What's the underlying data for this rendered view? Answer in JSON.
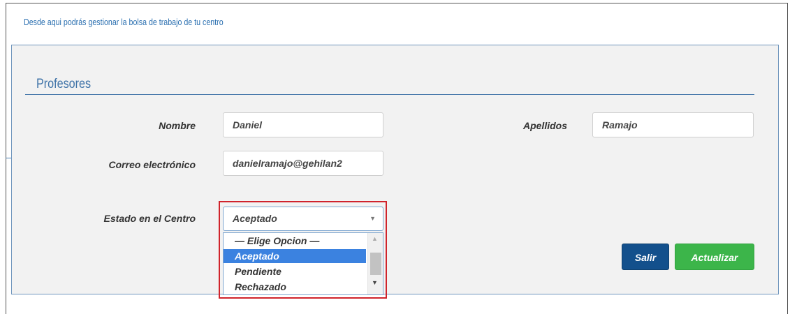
{
  "intro_text": "Desde aqui podrás gestionar la bolsa de trabajo de tu centro",
  "form": {
    "legend": "Profesores",
    "fields": {
      "nombre": {
        "label": "Nombre",
        "value": "Daniel"
      },
      "apellidos": {
        "label": "Apellidos",
        "value": "Ramajo"
      },
      "correo": {
        "label": "Correo electrónico",
        "value": "danielramajo@gehilan2"
      },
      "estado": {
        "label": "Estado en el Centro",
        "selected": "Aceptado",
        "options": [
          "— Elige Opcion —",
          "Aceptado",
          "Pendiente",
          "Rechazado"
        ]
      }
    },
    "buttons": {
      "salir": "Salir",
      "actualizar": "Actualizar"
    }
  },
  "colors": {
    "accent": "#3f73a8",
    "highlight_box": "#d0232b",
    "selected_option": "#3b82e0",
    "salir_button": "#13508c",
    "actualizar_button": "#3cb54a"
  }
}
